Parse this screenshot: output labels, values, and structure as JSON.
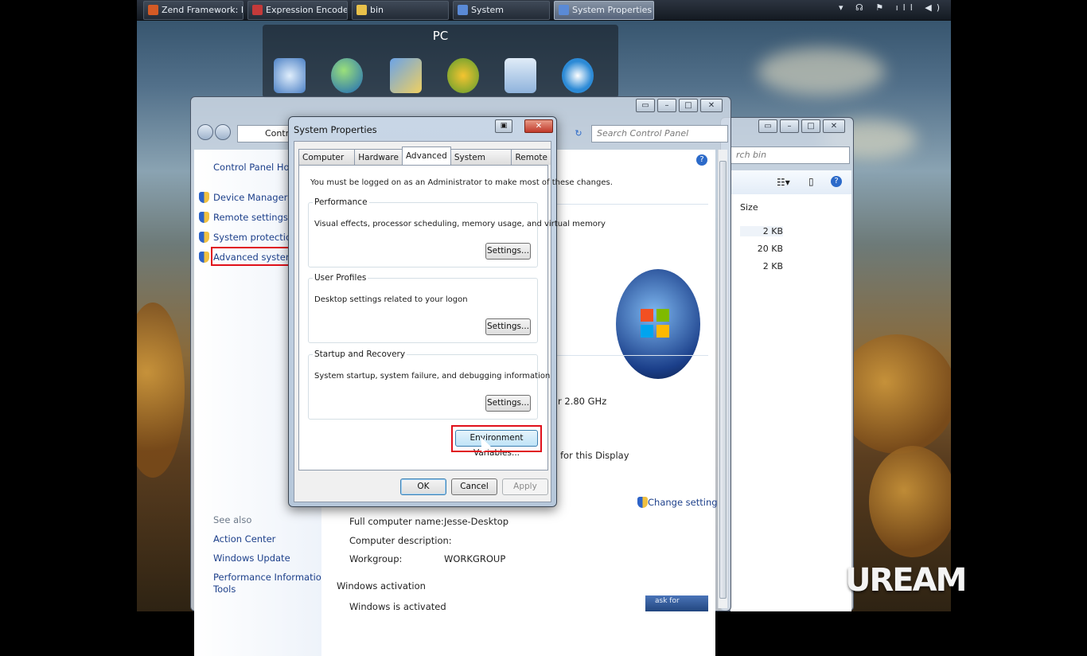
{
  "taskbar": {
    "items": [
      {
        "label": "Zend Framework: Do...",
        "color": "#d45a25"
      },
      {
        "label": "Expression Encoder S...",
        "color": "#c43a3a"
      },
      {
        "label": "bin",
        "color": "#e8c14a"
      },
      {
        "label": "System",
        "color": "#5a8ad6"
      },
      {
        "label": "System Properties",
        "color": "#5a8ad6"
      }
    ],
    "tray": "▾ ☊ ⚑ ıll ◀)"
  },
  "gadget": {
    "title": "PC"
  },
  "control_panel": {
    "address_short": "Contro",
    "search_placeholder": "Search Control Panel",
    "home_link": "Control Panel Home",
    "tasks": [
      "Device Manager",
      "Remote settings",
      "System protection",
      "Advanced system setti"
    ],
    "see_also_heading": "See also",
    "see_also": [
      "Action Center",
      "Windows Update",
      "Performance Information and",
      "Tools"
    ],
    "processor_suffix": "r  2.80 GHz",
    "display_suffix": "for this Display",
    "change_settings": "Change settings",
    "full_computer_name_label": "Full computer name:",
    "full_computer_name_value": "Jesse-Desktop",
    "computer_description_label": "Computer description:",
    "workgroup_label": "Workgroup:",
    "workgroup_value": "WORKGROUP",
    "activation_heading": "Windows activation",
    "activation_status": "Windows is activated",
    "ask_for": "ask for"
  },
  "explorer": {
    "search_placeholder": "rch bin",
    "size_header": "Size",
    "sizes": [
      "2 KB",
      "20 KB",
      "2 KB"
    ]
  },
  "dialog": {
    "title": "System Properties",
    "tabs": [
      "Computer Name",
      "Hardware",
      "Advanced",
      "System Protection",
      "Remote"
    ],
    "selected_tab": "Advanced",
    "admin_note": "You must be logged on as an Administrator to make most of these changes.",
    "performance": {
      "title": "Performance",
      "desc": "Visual effects, processor scheduling, memory usage, and virtual memory",
      "button": "Settings..."
    },
    "profiles": {
      "title": "User Profiles",
      "desc": "Desktop settings related to your logon",
      "button": "Settings..."
    },
    "startup": {
      "title": "Startup and Recovery",
      "desc": "System startup, system failure, and debugging information",
      "button": "Settings..."
    },
    "env_button": "Environment Variables...",
    "ok": "OK",
    "cancel": "Cancel",
    "apply": "Apply"
  },
  "watermark": "UREAM"
}
